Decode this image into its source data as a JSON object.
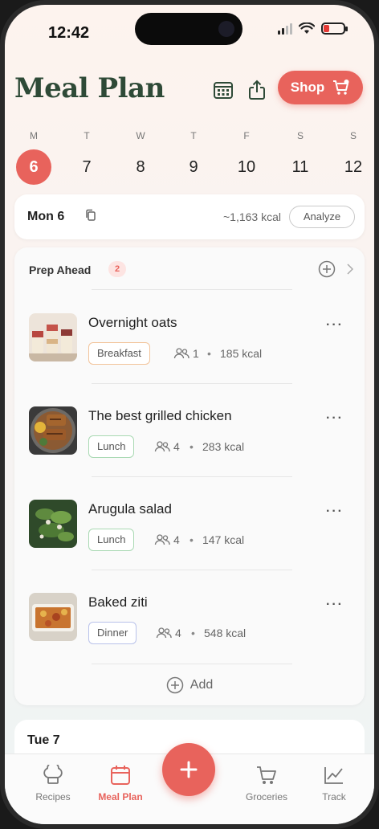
{
  "status": {
    "time": "12:42"
  },
  "header": {
    "title": "Meal Plan",
    "shop_label": "Shop"
  },
  "week": [
    {
      "letter": "M",
      "num": "6",
      "active": true
    },
    {
      "letter": "T",
      "num": "7"
    },
    {
      "letter": "W",
      "num": "8"
    },
    {
      "letter": "T",
      "num": "9"
    },
    {
      "letter": "F",
      "num": "10"
    },
    {
      "letter": "S",
      "num": "11"
    },
    {
      "letter": "S",
      "num": "12"
    }
  ],
  "day_card": {
    "label": "Mon 6",
    "kcal": "~1,163 kcal",
    "analyze": "Analyze"
  },
  "prep": {
    "title": "Prep Ahead",
    "count": "2"
  },
  "meals": [
    {
      "name": "Overnight oats",
      "tag": "Breakfast",
      "servings": "1",
      "kcal": "185 kcal",
      "tag_color": "#f2c49b"
    },
    {
      "name": "The best grilled chicken",
      "tag": "Lunch",
      "servings": "4",
      "kcal": "283 kcal",
      "tag_color": "#a9d9b3"
    },
    {
      "name": "Arugula salad",
      "tag": "Lunch",
      "servings": "4",
      "kcal": "147 kcal",
      "tag_color": "#a9d9b3"
    },
    {
      "name": "Baked ziti",
      "tag": "Dinner",
      "servings": "4",
      "kcal": "548 kcal",
      "tag_color": "#b9c2ea"
    }
  ],
  "add_label": "Add",
  "next_day": {
    "label": "Tue 7"
  },
  "dot": "•",
  "tabs": [
    {
      "label": "Recipes",
      "icon": "chef-hat-icon"
    },
    {
      "label": "Meal Plan",
      "icon": "calendar-icon",
      "active": true
    },
    {
      "label": "Groceries",
      "icon": "cart-icon"
    },
    {
      "label": "Track",
      "icon": "chart-line-icon"
    }
  ],
  "colors": {
    "accent": "#e8635c",
    "title": "#2e4a37"
  }
}
